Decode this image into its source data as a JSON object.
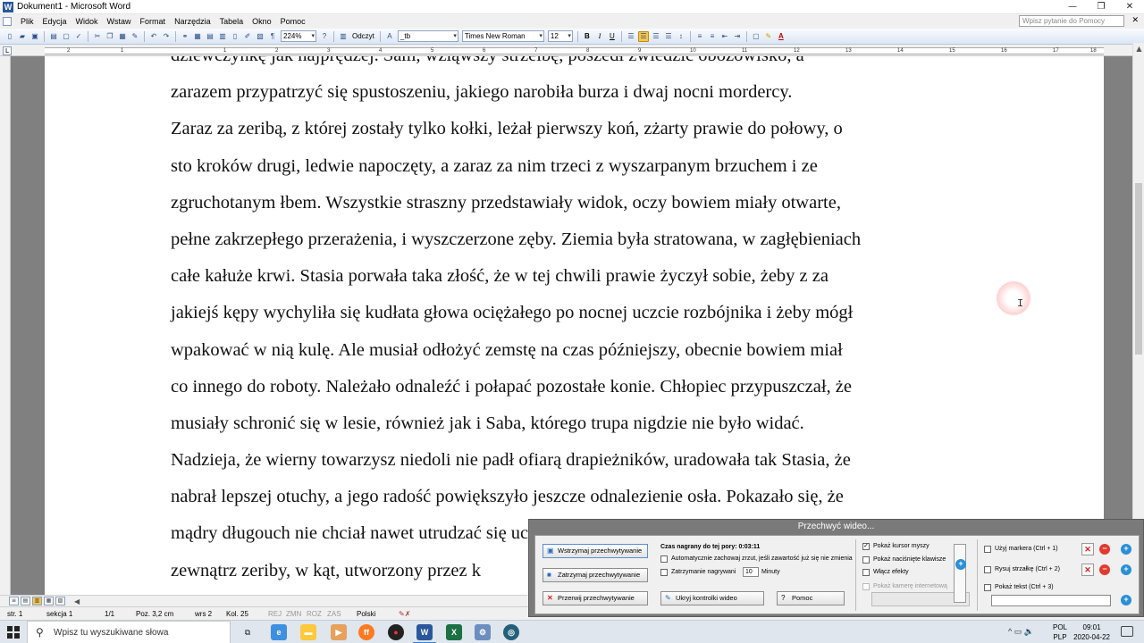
{
  "window": {
    "title": "Dokument1 - Microsoft Word",
    "app_icon": "W",
    "controls": [
      "—",
      "❐",
      "✕"
    ]
  },
  "menu": {
    "items": [
      "Plik",
      "Edycja",
      "Widok",
      "Wstaw",
      "Format",
      "Narzędzia",
      "Tabela",
      "Okno",
      "Pomoc"
    ],
    "help_placeholder": "Wpisz pytanie do Pomocy",
    "close_glyph": "✕"
  },
  "toolbar": {
    "zoom": "224%",
    "read_label": "Odczyt",
    "style": "_tb",
    "font": "Times New Roman",
    "size": "12",
    "bold": "B",
    "italic": "I",
    "underline": "U",
    "font_color": "A"
  },
  "ruler": {
    "corner": "L",
    "marks": [
      "2",
      "1",
      "1",
      "2",
      "3",
      "4",
      "5",
      "6",
      "7",
      "8",
      "9",
      "10",
      "11",
      "12",
      "13",
      "14",
      "15",
      "16",
      "17",
      "18"
    ]
  },
  "document": {
    "lines": [
      "dziewczynkę jak najprędzej. Sam, wziąwszy strzelbę, poszedł zwiedzić obozowisko, a",
      "zarazem przypatrzyć się spustoszeniu, jakiego narobiła burza i dwaj nocni mordercy.",
      " Zaraz za zeribą, z której zostały tylko kołki, leżał pierwszy koń, zżarty prawie do połowy, o",
      "sto kroków drugi, ledwie napoczęty, a zaraz za nim trzeci z wyszarpanym brzuchem i ze",
      "zgruchotanym łbem. Wszystkie straszny przedstawiały widok, oczy bowiem miały otwarte,",
      "pełne zakrzepłego przerażenia, i wyszczerzone zęby. Ziemia była stratowana, w zagłębieniach",
      "całe kałuże krwi. Stasia porwała taka złość, że w tej chwili prawie życzył sobie, żeby z za",
      "jakiejś kępy wychyliła się kudłata głowa ociężałego po nocnej uczcie rozbójnika i żeby mógł",
      "wpakować w nią kulę. Ale musiał odłożyć zemstę na czas późniejszy, obecnie bowiem miał",
      "co innego do roboty. Należało odnaleźć i połapać pozostałe konie. Chłopiec przypuszczał, że",
      "musiały schronić się w lesie, również jak i Saba, którego trupa nigdzie nie było widać.",
      "Nadzieja, że wierny towarzysz niedoli nie padł ofiarą drapieżników, uradowała tak Stasia, że",
      "nabrał lepszej otuchy, a jego radość powiększyło jeszcze odnalezienie osła. Pokazało się, że",
      "mądry długouch nie chciał nawet utrudzać się ucieczką do lasu, ale schował się",
      "zewnątrz zeriby, w kąt, utworzony przez k"
    ]
  },
  "view_buttons": [
    "≡",
    "▤",
    "▥",
    "▦",
    "▧"
  ],
  "scroll_arrows": {
    "left": "◀",
    "right": "▶",
    "up": "▲",
    "down": "▼"
  },
  "status": {
    "page": "str. 1",
    "section": "sekcja 1",
    "pages": "1/1",
    "position": "Poz. 3,2 cm",
    "line": "wrs 2",
    "column": "Kol. 25",
    "rej": "REJ",
    "zmn": "ZMN",
    "roz": "ROZ",
    "zas": "ZAS",
    "language": "Polski"
  },
  "capture_dialog": {
    "title": "Przechwyć wideo...",
    "pause_btn": "Wstrzymaj przechwytywanie",
    "stop_btn": "Zatrzymaj przechwytywanie",
    "abort_btn": "Przerwij przechwytywanie",
    "time_label": "Czas nagrany do tej pory: 0:03:11",
    "auto_save": "Automatycznie zachowaj zrzut, jeśli zawartość już się nie zmienia",
    "stop_recording": "Zatrzymanie nagrywani",
    "minutes_value": "10",
    "minutes_label": "Minuty",
    "hide_controls": "Ukryj kontrolki wideo",
    "help": "Pomoc",
    "show_cursor": "Pokaż kursor myszy",
    "show_keys": "Pokaż naciśnięte klawisze",
    "enable_effects": "Włącz efekty",
    "show_camera": "Pokaż kamerę internetową",
    "use_marker": "Użyj markera (Ctrl + 1)",
    "draw_arrow": "Rysuj strzałkę (Ctrl + 2)",
    "show_text": "Pokaż tekst (Ctrl + 3)",
    "check_glyph": "✓"
  },
  "taskbar": {
    "search_placeholder": "Wpisz tu wyszukiwane słowa",
    "lang_top": "POL",
    "lang_bottom": "PLP",
    "time": "09:01",
    "date": "2020-04-22",
    "tray_icons": "^ ▭ 🔉"
  }
}
